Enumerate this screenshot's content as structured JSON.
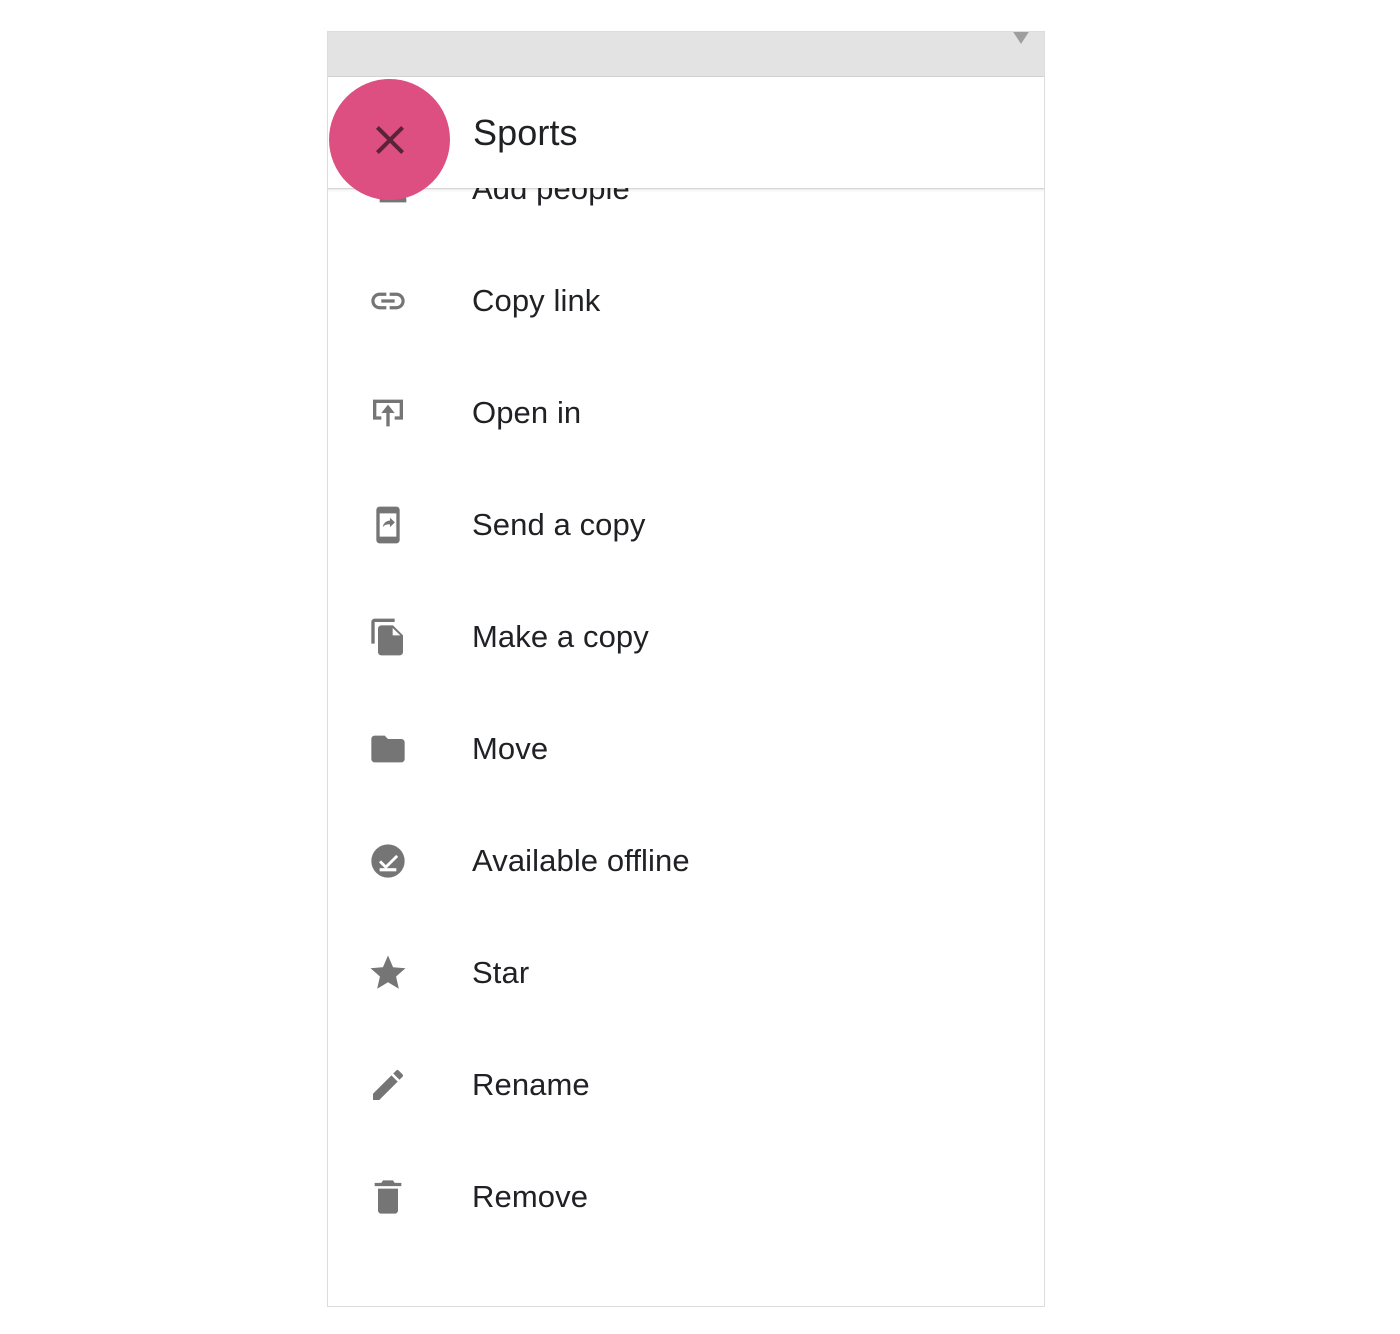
{
  "window": {
    "titlebar": {
      "controls": [
        {
          "name": "stop-square-button",
          "icon": "square-icon"
        },
        {
          "name": "record-circle-button",
          "icon": "circle-icon"
        },
        {
          "name": "dropdown-button",
          "icon": "triangle-down-icon"
        }
      ]
    }
  },
  "appbar": {
    "title": "Sports",
    "close_icon": "close-x-icon",
    "close_label": "Close"
  },
  "colors": {
    "accent_pink": "#dd4f80",
    "close_glyph": "#5a2336",
    "icon_gray": "#757575",
    "text": "#202124",
    "titlebar_bg": "#e3e3e3",
    "window_border": "#dcdcdc"
  },
  "menu": {
    "items": [
      {
        "label": "Add people",
        "icon": "person-add-icon"
      },
      {
        "label": "Copy link",
        "icon": "link-icon"
      },
      {
        "label": "Open in",
        "icon": "launch-icon"
      },
      {
        "label": "Send a copy",
        "icon": "phone-share-icon"
      },
      {
        "label": "Make a copy",
        "icon": "content-copy-icon"
      },
      {
        "label": "Move",
        "icon": "folder-icon"
      },
      {
        "label": "Available offline",
        "icon": "offline-pin-icon"
      },
      {
        "label": "Star",
        "icon": "star-icon"
      },
      {
        "label": "Rename",
        "icon": "pencil-icon"
      },
      {
        "label": "Remove",
        "icon": "trash-icon"
      }
    ]
  }
}
